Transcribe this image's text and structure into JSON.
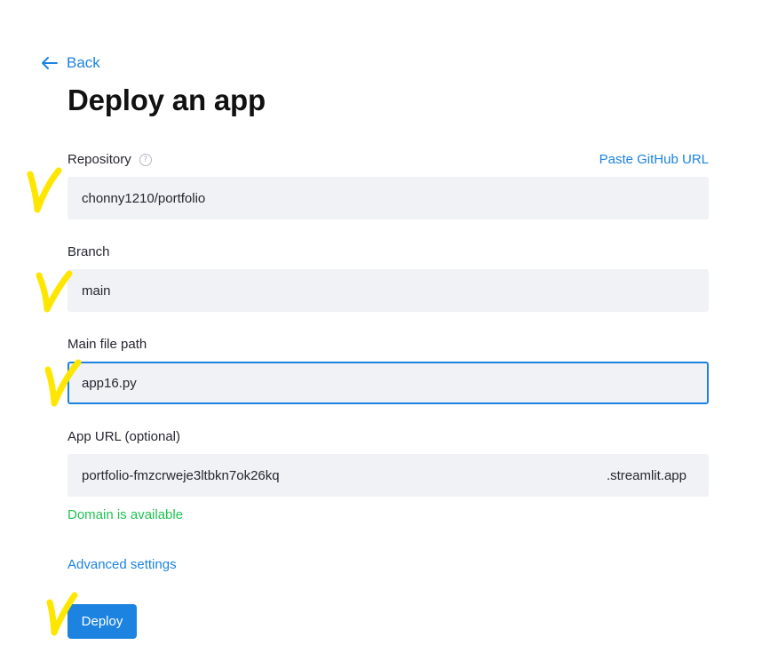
{
  "nav": {
    "back_label": "Back"
  },
  "page": {
    "title": "Deploy an app"
  },
  "repository": {
    "label": "Repository",
    "value": "chonny1210/portfolio",
    "paste_link": "Paste GitHub URL"
  },
  "branch": {
    "label": "Branch",
    "value": "main"
  },
  "main_file": {
    "label": "Main file path",
    "value": "app16.py"
  },
  "app_url": {
    "label": "App URL (optional)",
    "value": "portfolio-fmzcrweje3ltbkn7ok26kq",
    "suffix": ".streamlit.app",
    "status": "Domain is available"
  },
  "advanced": {
    "label": "Advanced settings"
  },
  "deploy": {
    "label": "Deploy"
  },
  "annotations": {
    "mark_color": "#ffe600",
    "mark_icon": "handwritten-check-mark"
  },
  "colors": {
    "accent": "#1c83e1",
    "success": "#21c354",
    "input_bg": "#f0f2f6"
  }
}
